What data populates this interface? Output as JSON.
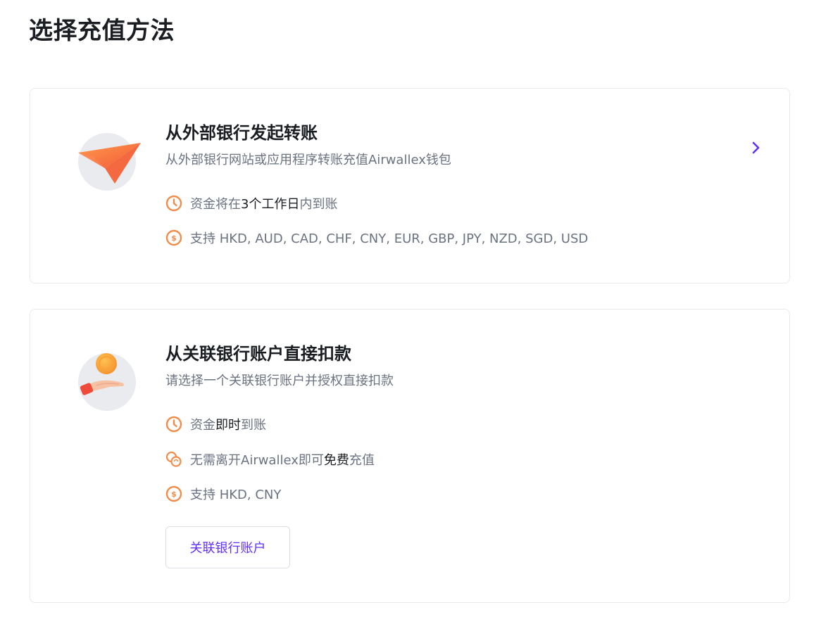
{
  "page": {
    "title": "选择充值方法"
  },
  "colors": {
    "accent": "#612fff",
    "icon_orange": "#f08c4a",
    "text_primary": "#1a1d21",
    "text_secondary": "#6b7280"
  },
  "external_transfer": {
    "title": "从外部银行发起转账",
    "subtitle": "从外部银行网站或应用程序转账充值Airwallex钱包",
    "illustration": "paper-plane",
    "features": [
      {
        "icon": "clock-icon",
        "prefix": "资金将在",
        "highlight": "3个工作日",
        "suffix": "内到账"
      },
      {
        "icon": "dollar-coin-icon",
        "text": "支持 HKD, AUD, CAD, CHF, CNY, EUR, GBP, JPY, NZD, SGD, USD"
      }
    ]
  },
  "direct_debit": {
    "title": "从关联银行账户直接扣款",
    "subtitle": "请选择一个关联银行账户并授权直接扣款",
    "illustration": "hand-with-coin",
    "features": [
      {
        "icon": "clock-icon",
        "prefix": "资金",
        "highlight": "即时",
        "suffix": "到账"
      },
      {
        "icon": "coins-icon",
        "prefix": "无需离开Airwallex即可",
        "highlight": "免费",
        "suffix": "充值"
      },
      {
        "icon": "dollar-coin-icon",
        "text": "支持 HKD, CNY"
      }
    ],
    "button_label": "关联银行账户"
  }
}
